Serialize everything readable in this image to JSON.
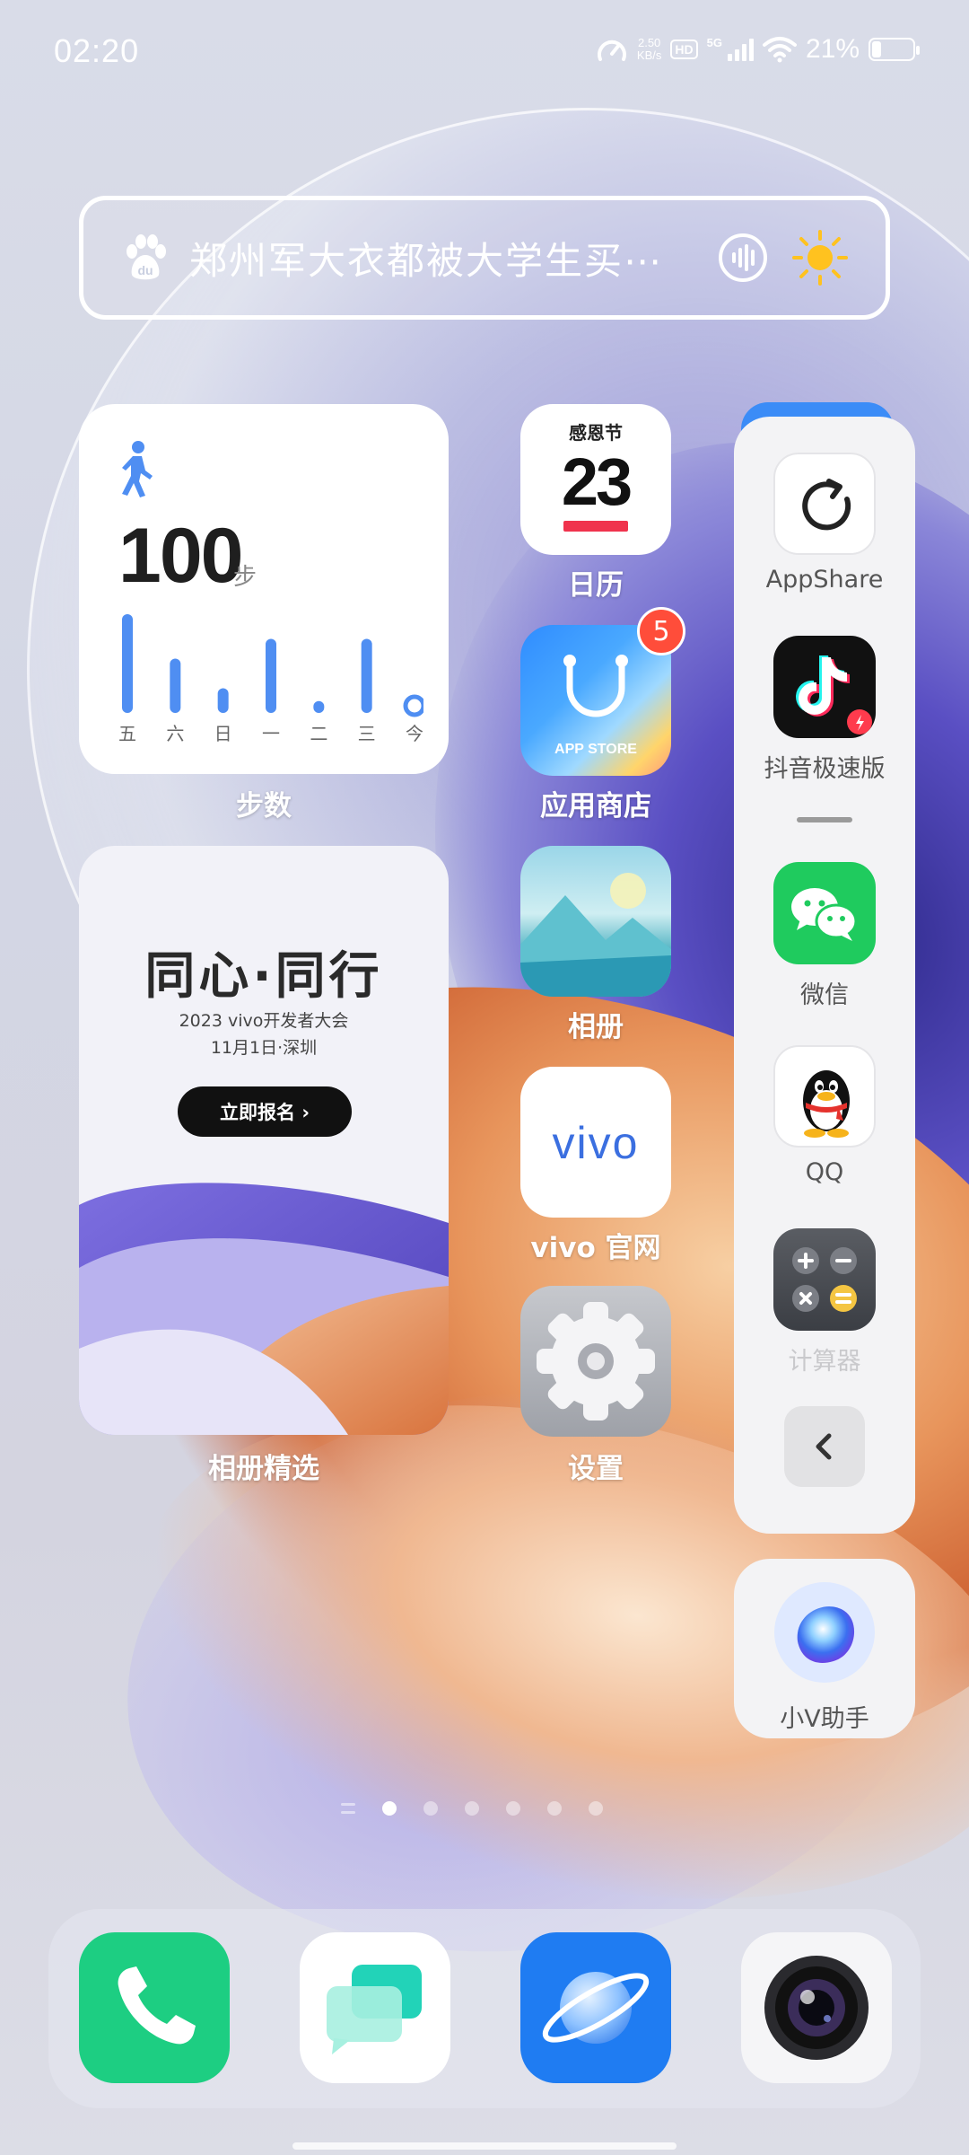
{
  "status_bar": {
    "time": "02:20",
    "net_speed_value": "2.50",
    "net_speed_unit": "KB/s",
    "hd": "HD",
    "network": "5G",
    "battery": "21%"
  },
  "search": {
    "text": "郑州军大衣都被大学生买⋯"
  },
  "steps_widget": {
    "value": "100",
    "unit": "步",
    "days": [
      "五",
      "六",
      "日",
      "一",
      "二",
      "三",
      "今"
    ],
    "bar_levels": [
      1.0,
      0.55,
      0.25,
      0.75,
      0.12,
      0.75,
      0.0
    ],
    "label": "步数"
  },
  "calendar_app": {
    "festival": "感恩节",
    "day": "23",
    "label": "日历"
  },
  "store_app": {
    "icon_text": "APP STORE",
    "label": "应用商店",
    "badge": "5"
  },
  "photos_app": {
    "label": "相册"
  },
  "vivo_app": {
    "icon_text": "vivo",
    "label": "vivo 官网"
  },
  "settings_app": {
    "label": "设置"
  },
  "album_widget": {
    "title": "同心·同行",
    "subtitle1": "2023 vivo开发者大会",
    "subtitle2": "11月1日·深圳",
    "button": "立即报名 ›",
    "label": "相册精选"
  },
  "side_panel": {
    "items": [
      {
        "label": "AppShare"
      },
      {
        "label": "抖音极速版"
      },
      {
        "label": "微信"
      },
      {
        "label": "QQ"
      },
      {
        "label": "计算器"
      }
    ],
    "assistant_label": "小V助手"
  },
  "page_indicator": {
    "count": 6,
    "active": 0
  },
  "dock": {
    "apps": [
      "phone",
      "messages",
      "browser",
      "camera"
    ]
  },
  "colors": {
    "accent_blue": "#3b8cf7",
    "badge_red": "#ff4d3a",
    "wechat_green": "#1fcb5e",
    "phone_green": "#1dce82"
  }
}
